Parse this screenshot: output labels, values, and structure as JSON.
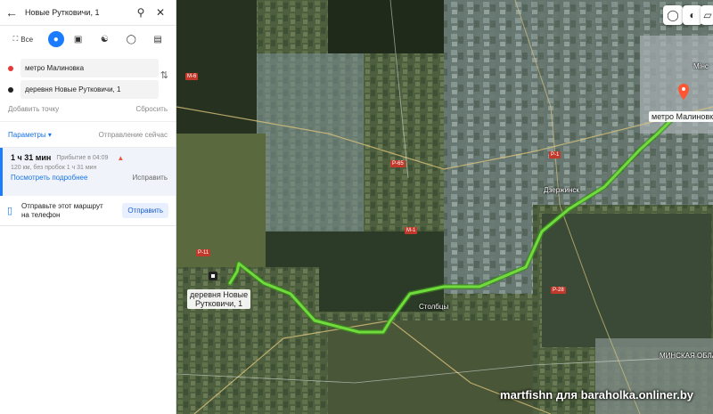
{
  "search": {
    "query": "Новые Рутковичи, 1"
  },
  "modes": {
    "all_label": "Все"
  },
  "points": {
    "from": "метро Малиновка",
    "to": "деревня Новые Рутковичи, 1",
    "from_color": "#e53935",
    "to_color": "#222222"
  },
  "actions": {
    "add_point": "Добавить точку",
    "reset": "Сбросить"
  },
  "params": {
    "label": "Параметры",
    "departure": "Отправление сейчас"
  },
  "route": {
    "duration": "1 ч 31 мин",
    "arrival": "Прибытие в 04:09",
    "details": "120 км, без пробок 1 ч 31 мин",
    "more": "Посмотреть подробнее",
    "edit": "Исправить"
  },
  "send": {
    "text_line1": "Отправьте этот маршрут",
    "text_line2": "на телефон",
    "button": "Отправить"
  },
  "map": {
    "start_label": "метро Малиновка",
    "end_label_line1": "деревня Новые",
    "end_label_line2": "Рутковичи, 1",
    "city_labels": [
      "Дзержинск",
      "Столбцы",
      "МИНСКАЯ ОБЛАСТЬ",
      "Мінс"
    ],
    "road_badges": [
      "Р-1",
      "Р-11",
      "Р-65",
      "Р-28",
      "М-1",
      "М-6"
    ],
    "route_color": "#6fdc3c",
    "watermark": "martfishn для baraholka.onliner.by"
  }
}
